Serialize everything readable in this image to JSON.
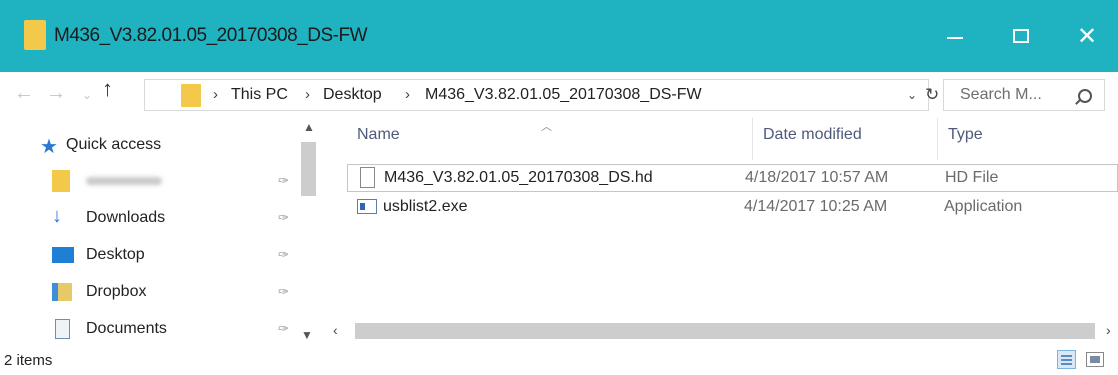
{
  "window": {
    "title": "M436_V3.82.01.05_20170308_DS-FW",
    "minimize_glyph": "—",
    "maximize_glyph": "☐",
    "close_glyph": "✕"
  },
  "toolbar": {
    "back_glyph": "←",
    "forward_glyph": "→",
    "recent_glyph": "⌄",
    "up_glyph": "↑"
  },
  "address": {
    "separator": "›",
    "crumbs": [
      "This PC",
      "Desktop",
      "M436_V3.82.01.05_20170308_DS-FW"
    ],
    "dropdown_glyph": "⌄",
    "refresh_glyph": "↻"
  },
  "search": {
    "placeholder": "Search M..."
  },
  "nav": {
    "quick_access": "Quick access",
    "items": [
      {
        "label": "",
        "icon": "folder-icon",
        "blurred": true
      },
      {
        "label": "Downloads",
        "icon": "download-icon"
      },
      {
        "label": "Desktop",
        "icon": "desktop-icon"
      },
      {
        "label": "Dropbox",
        "icon": "dropbox-icon"
      },
      {
        "label": "Documents",
        "icon": "documents-icon"
      }
    ],
    "pin_glyph": "📌"
  },
  "columns": {
    "name": "Name",
    "date": "Date modified",
    "type": "Type"
  },
  "files": [
    {
      "name": "M436_V3.82.01.05_20170308_DS.hd",
      "date": "4/18/2017 10:57 AM",
      "type": "HD File",
      "icon": "document-icon",
      "selected": true
    },
    {
      "name": "usblist2.exe",
      "date": "4/14/2017 10:25 AM",
      "type": "Application",
      "icon": "application-icon",
      "selected": false
    }
  ],
  "status": {
    "count": "2 items"
  },
  "colors": {
    "titlebar": "#1fb3c1",
    "folder": "#f3c94c",
    "accent": "#2b79d0"
  }
}
